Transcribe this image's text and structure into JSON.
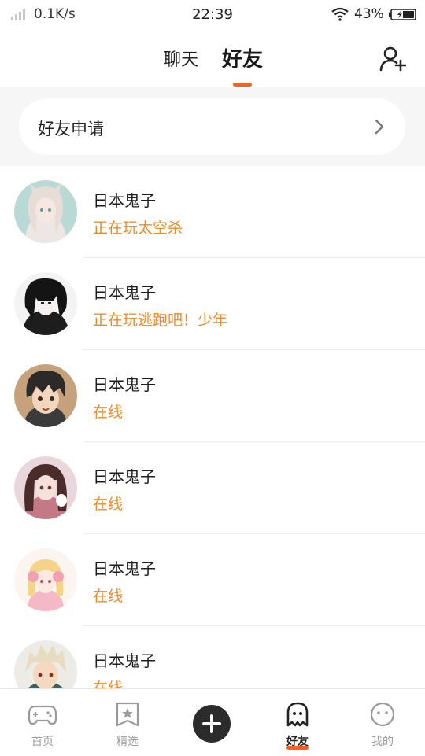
{
  "status_bar": {
    "speed": "0.1K/s",
    "time": "22:39",
    "battery": "43%"
  },
  "header": {
    "tabs": [
      {
        "label": "聊天",
        "active": false
      },
      {
        "label": "好友",
        "active": true
      }
    ],
    "accent_color": "#f26322",
    "add_friend_icon": "add-user-icon"
  },
  "friend_request": {
    "label": "好友申请",
    "icon": "chevron-right-icon"
  },
  "friends": [
    {
      "name": "日本鬼子",
      "status": "正在玩太空杀"
    },
    {
      "name": "日本鬼子",
      "status": "正在玩逃跑吧！少年"
    },
    {
      "name": "日本鬼子",
      "status": "在线"
    },
    {
      "name": "日本鬼子",
      "status": "在线"
    },
    {
      "name": "日本鬼子",
      "status": "在线"
    },
    {
      "name": "日本鬼子",
      "status": "在线"
    }
  ],
  "status_color": "#f08a24",
  "bottom_nav": {
    "items": [
      {
        "label": "首页",
        "icon": "gamepad-icon"
      },
      {
        "label": "精选",
        "icon": "star-bookmark-icon"
      },
      {
        "label": "",
        "icon": "plus-icon"
      },
      {
        "label": "好友",
        "icon": "ghost-icon",
        "active": true
      },
      {
        "label": "我的",
        "icon": "face-icon"
      }
    ]
  }
}
